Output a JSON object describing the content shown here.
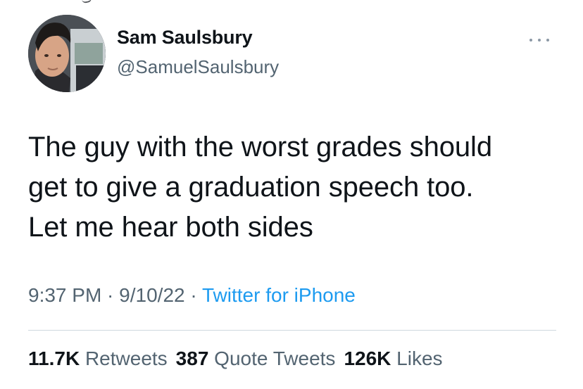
{
  "author": {
    "name": "Sam Saulsbury",
    "handle": "@SamuelSaulsbury",
    "avatar_icon": "profile-photo"
  },
  "tweet": {
    "text": "The guy with the worst grades should\nget to give a graduation speech too.\nLet me hear both sides"
  },
  "meta": {
    "time": "9:37 PM",
    "separator": " · ",
    "date": "9/10/22",
    "source": "Twitter for iPhone"
  },
  "stats": {
    "retweets_count": "11.7K",
    "retweets_label": "Retweets",
    "quotes_count": "387",
    "quotes_label": "Quote Tweets",
    "likes_count": "126K",
    "likes_label": "Likes"
  },
  "colors": {
    "text": "#0f1419",
    "secondary": "#536471",
    "link": "#1d9bf0",
    "divider": "#cfd9de"
  },
  "icons": {
    "more": "more-horizontal-icon"
  }
}
